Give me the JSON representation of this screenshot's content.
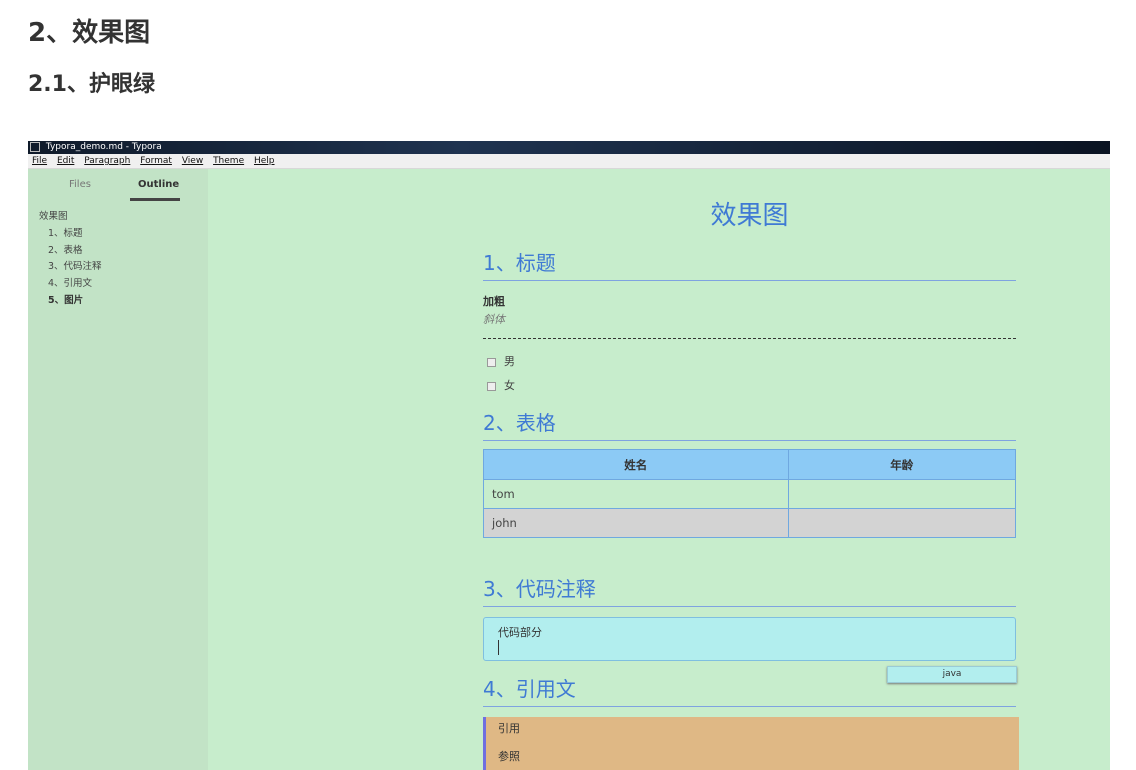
{
  "page": {
    "heading": "2、效果图",
    "subheading": "2.1、护眼绿"
  },
  "window": {
    "title": "Typora_demo.md - Typora",
    "menu": [
      "File",
      "Edit",
      "Paragraph",
      "Format",
      "View",
      "Theme",
      "Help"
    ]
  },
  "sidebar": {
    "tabs": [
      "Files",
      "Outline"
    ],
    "active_tab": "Outline",
    "outline": [
      {
        "label": "效果图",
        "level": 1
      },
      {
        "label": "1、标题",
        "level": 2
      },
      {
        "label": "2、表格",
        "level": 2
      },
      {
        "label": "3、代码注释",
        "level": 2
      },
      {
        "label": "4、引用文",
        "level": 2
      },
      {
        "label": "5、图片",
        "level": 2,
        "active": true
      }
    ]
  },
  "document": {
    "title": "效果图",
    "sections": {
      "heading1": "1、标题",
      "bold": "加粗",
      "italic": "斜体",
      "tasks": [
        "男",
        "女"
      ],
      "heading2": "2、表格",
      "table": {
        "headers": [
          "姓名",
          "年龄"
        ],
        "rows": [
          [
            "tom",
            ""
          ],
          [
            "john",
            ""
          ]
        ]
      },
      "heading3": "3、代码注释",
      "code": "代码部分",
      "code_lang": "java",
      "heading4": "4、引用文",
      "quote": [
        "引用",
        "参照"
      ]
    }
  },
  "colors": {
    "background": "#c7edcc",
    "accent": "#3f7ad4",
    "table_header": "#8ccaf5",
    "code_bg": "#b2eeee",
    "quote_bg": "#dfb885"
  }
}
